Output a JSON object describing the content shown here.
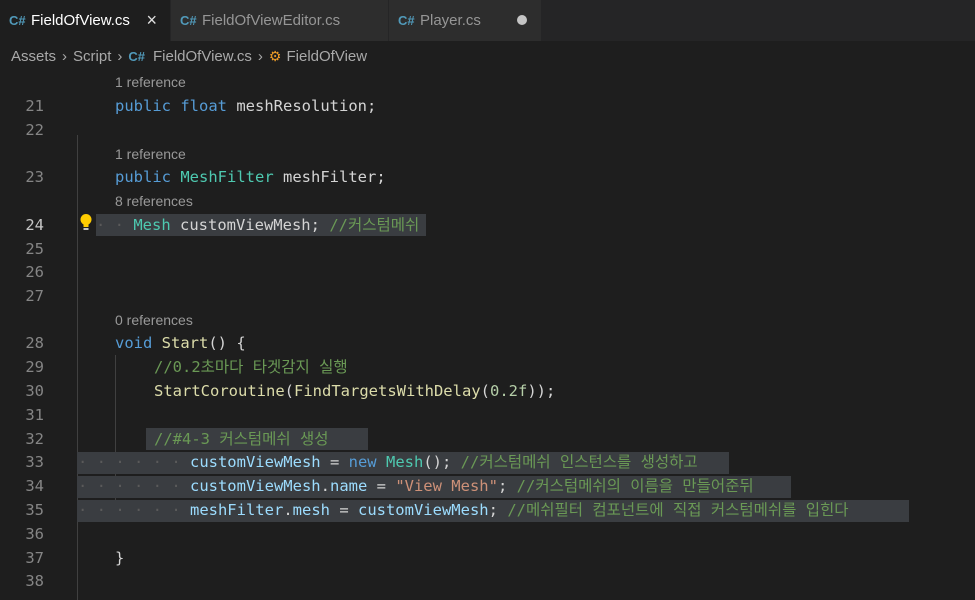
{
  "tabs": [
    {
      "label": "FieldOfView.cs",
      "icon": "csharp-icon",
      "active": true,
      "close": "×"
    },
    {
      "label": "FieldOfViewEditor.cs",
      "icon": "csharp-icon"
    },
    {
      "label": "Player.cs",
      "icon": "csharp-icon",
      "unsaved": true
    }
  ],
  "breadcrumb": {
    "b0": "Assets",
    "b1": "Script",
    "b2": "FieldOfView.cs",
    "b3": "FieldOfView"
  },
  "lens": {
    "l20": "1 reference",
    "l23": "1 reference",
    "l24": "8 references",
    "l28": "0 references"
  },
  "lines": {
    "n21": "21",
    "n22": "22",
    "n23": "23",
    "n24": "24",
    "n25": "25",
    "n26": "26",
    "n27": "27",
    "n28": "28",
    "n29": "29",
    "n30": "30",
    "n31": "31",
    "n32": "32",
    "n33": "33",
    "n34": "34",
    "n35": "35",
    "n36": "36",
    "n37": "37",
    "n38": "38"
  },
  "code": {
    "l21_kw1": "public",
    "l21_kw2": "float",
    "l21_rest": " meshResolution;",
    "l23_kw": "public",
    "l23_ty": "MeshFilter",
    "l23_rest": " meshFilter;",
    "l24_dots": "· · ",
    "l24_ty": "Mesh",
    "l24_rest": " customViewMesh;",
    "l24_cm": "//커스텀메쉬",
    "l28_kw": "void",
    "l28_fn": "Start",
    "l28_rest": "() {",
    "l29_cm": "//0.2초마다 타겟감지 실행",
    "l30_fn": "StartCoroutine",
    "l30_p1": "(",
    "l30_fn2": "FindTargetsWithDelay",
    "l30_p2": "(",
    "l30_num": "0.2f",
    "l30_p3": "));",
    "l32_cm": "//#4-3 커스텀메쉬 생성",
    "l33_dots": "· · · · · · ",
    "l33_id": "customViewMesh",
    "l33_eq": " = ",
    "l33_kw": "new",
    "l33_ty": "Mesh",
    "l33_rest": "();",
    "l33_cm": "//커스텀메쉬 인스턴스를 생성하고",
    "l34_dots": "· · · · · · ",
    "l34_id": "customViewMesh",
    "l34_dot": ".",
    "l34_id2": "name",
    "l34_eq": " = ",
    "l34_str": "\"View Mesh\"",
    "l34_semi": ";",
    "l34_cm": "//커스텀메쉬의 이름을 만들어준뒤",
    "l35_dots": "· · · · · · ",
    "l35_id": "meshFilter",
    "l35_dot": ".",
    "l35_id2": "mesh",
    "l35_eq": " = ",
    "l35_id3": "customViewMesh",
    "l35_semi": ";",
    "l35_cm": "//메쉬필터 컴포넌트에 직접 커스텀메쉬를 입힌다",
    "l37": "}"
  },
  "colors": {
    "keyword": "#569cd6",
    "type": "#4ec9b0",
    "function": "#dcdcaa",
    "string": "#ce9178",
    "number": "#b5cea8",
    "comment": "#6a9955",
    "variable": "#9cdcfe"
  }
}
